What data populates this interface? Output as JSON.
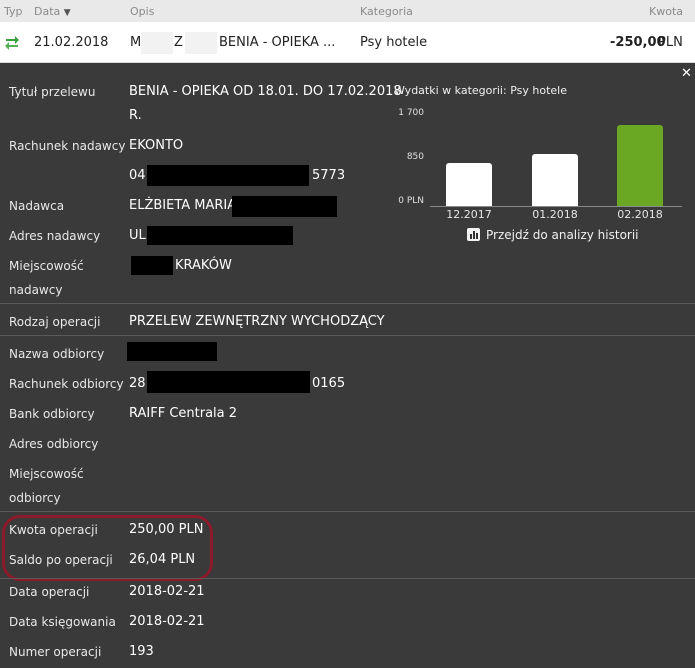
{
  "header": {
    "col_typ": "Typ",
    "col_data": "Data",
    "col_opis": "Opis",
    "col_kategoria": "Kategoria",
    "col_kwota": "Kwota"
  },
  "transaction_row": {
    "date": "21.02.2018",
    "desc_part1": "M",
    "desc_part2": "Z",
    "desc_part3": "BENIA - OPIEKA ...",
    "category": "Psy hotele",
    "amount": "-250,00",
    "currency": "PLN",
    "transfer_icon_color": "#3aa13a"
  },
  "details": {
    "tytul_label": "Tytuł przelewu",
    "tytul_value_1": "BENIA - OPIEKA OD 18.01. DO 17.02.2018",
    "tytul_value_2": "R.",
    "rachunek_nadawcy_label": "Rachunek nadawcy",
    "rachunek_nadawcy_value": "EKONTO",
    "rachunek_nadawcy_prefix": "04",
    "rachunek_nadawcy_suffix": "5773",
    "nadawca_label": "Nadawca",
    "nadawca_value": "ELŻBIETA MARIA",
    "adres_nadawcy_label": "Adres nadawcy",
    "adres_nadawcy_value": "UL",
    "miejscowosc_nadawcy_label_1": "Miejscowość",
    "miejscowosc_nadawcy_label_2": "nadawcy",
    "miejscowosc_nadawcy_value": "KRAKÓW",
    "rodzaj_operacji_label": "Rodzaj operacji",
    "rodzaj_operacji_value": "PRZELEW ZEWNĘTRZNY WYCHODZĄCY",
    "nazwa_odbiorcy_label": "Nazwa odbiorcy",
    "rachunek_odbiorcy_label": "Rachunek odbiorcy",
    "rachunek_odbiorcy_prefix": "28",
    "rachunek_odbiorcy_suffix": "0165",
    "bank_odbiorcy_label": "Bank odbiorcy",
    "bank_odbiorcy_value": "RAIFF Centrala 2",
    "adres_odbiorcy_label": "Adres odbiorcy",
    "miejscowosc_odbiorcy_label_1": "Miejscowość",
    "miejscowosc_odbiorcy_label_2": "odbiorcy",
    "kwota_operacji_label": "Kwota operacji",
    "kwota_operacji_value": "250,00 PLN",
    "saldo_label": "Saldo po operacji",
    "saldo_value": "26,04 PLN",
    "data_operacji_label": "Data operacji",
    "data_operacji_value": "2018-02-21",
    "data_ksiegowania_label": "Data księgowania",
    "data_ksiegowania_value": "2018-02-21",
    "numer_operacji_label": "Numer operacji",
    "numer_operacji_value": "193"
  },
  "chart_data": {
    "type": "bar",
    "title": "Wydatki w kategorii:  Psy hotele",
    "categories": [
      "12.2017",
      "01.2018",
      "02.2018"
    ],
    "values": [
      800,
      960,
      1500
    ],
    "y_ticks": [
      "1 700",
      "850",
      "0 PLN"
    ],
    "ylim": [
      0,
      1700
    ],
    "bar_colors": [
      "#ffffff",
      "#ffffff",
      "#6aa823"
    ]
  },
  "history_link": "Przejdź do analizy historii"
}
